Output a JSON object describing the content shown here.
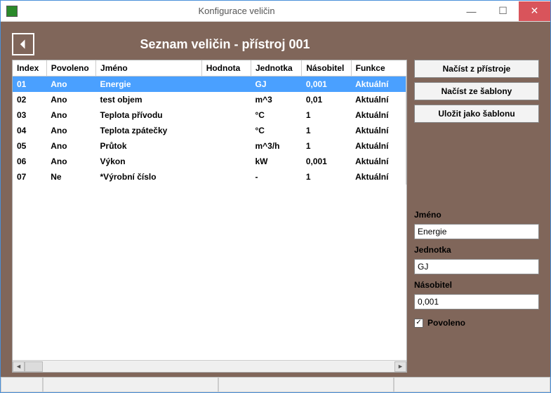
{
  "window": {
    "title": "Konfigurace veličin"
  },
  "page": {
    "title": "Seznam veličin - přístroj 001"
  },
  "table": {
    "headers": {
      "index": "Index",
      "povoleno": "Povoleno",
      "jmeno": "Jméno",
      "hodnota": "Hodnota",
      "jednotka": "Jednotka",
      "nasobitel": "Násobitel",
      "funkce": "Funkce"
    },
    "rows": [
      {
        "index": "01",
        "povoleno": "Ano",
        "jmeno": "Energie",
        "hodnota": "",
        "jednotka": "GJ",
        "nasobitel": "0,001",
        "funkce": "Aktuální",
        "selected": true
      },
      {
        "index": "02",
        "povoleno": "Ano",
        "jmeno": "test objem",
        "hodnota": "",
        "jednotka": "m^3",
        "nasobitel": "0,01",
        "funkce": "Aktuální"
      },
      {
        "index": "03",
        "povoleno": "Ano",
        "jmeno": "Teplota přívodu",
        "hodnota": "",
        "jednotka": "°C",
        "nasobitel": "1",
        "funkce": "Aktuální"
      },
      {
        "index": "04",
        "povoleno": "Ano",
        "jmeno": "Teplota zpátečky",
        "hodnota": "",
        "jednotka": "°C",
        "nasobitel": "1",
        "funkce": "Aktuální"
      },
      {
        "index": "05",
        "povoleno": "Ano",
        "jmeno": "Průtok",
        "hodnota": "",
        "jednotka": "m^3/h",
        "nasobitel": "1",
        "funkce": "Aktuální"
      },
      {
        "index": "06",
        "povoleno": "Ano",
        "jmeno": "Výkon",
        "hodnota": "",
        "jednotka": "kW",
        "nasobitel": "0,001",
        "funkce": "Aktuální"
      },
      {
        "index": "07",
        "povoleno": "Ne",
        "jmeno": "*Výrobní číslo",
        "hodnota": "",
        "jednotka": "-",
        "nasobitel": "1",
        "funkce": "Aktuální"
      }
    ]
  },
  "buttons": {
    "load_device": "Načíst z přístroje",
    "load_template": "Načíst ze šablony",
    "save_template": "Uložit jako šablonu"
  },
  "form": {
    "jmeno_label": "Jméno",
    "jmeno_value": "Energie",
    "jednotka_label": "Jednotka",
    "jednotka_value": "GJ",
    "nasobitel_label": "Násobitel",
    "nasobitel_value": "0,001",
    "povoleno_label": "Povoleno",
    "povoleno_checked": "✓"
  }
}
